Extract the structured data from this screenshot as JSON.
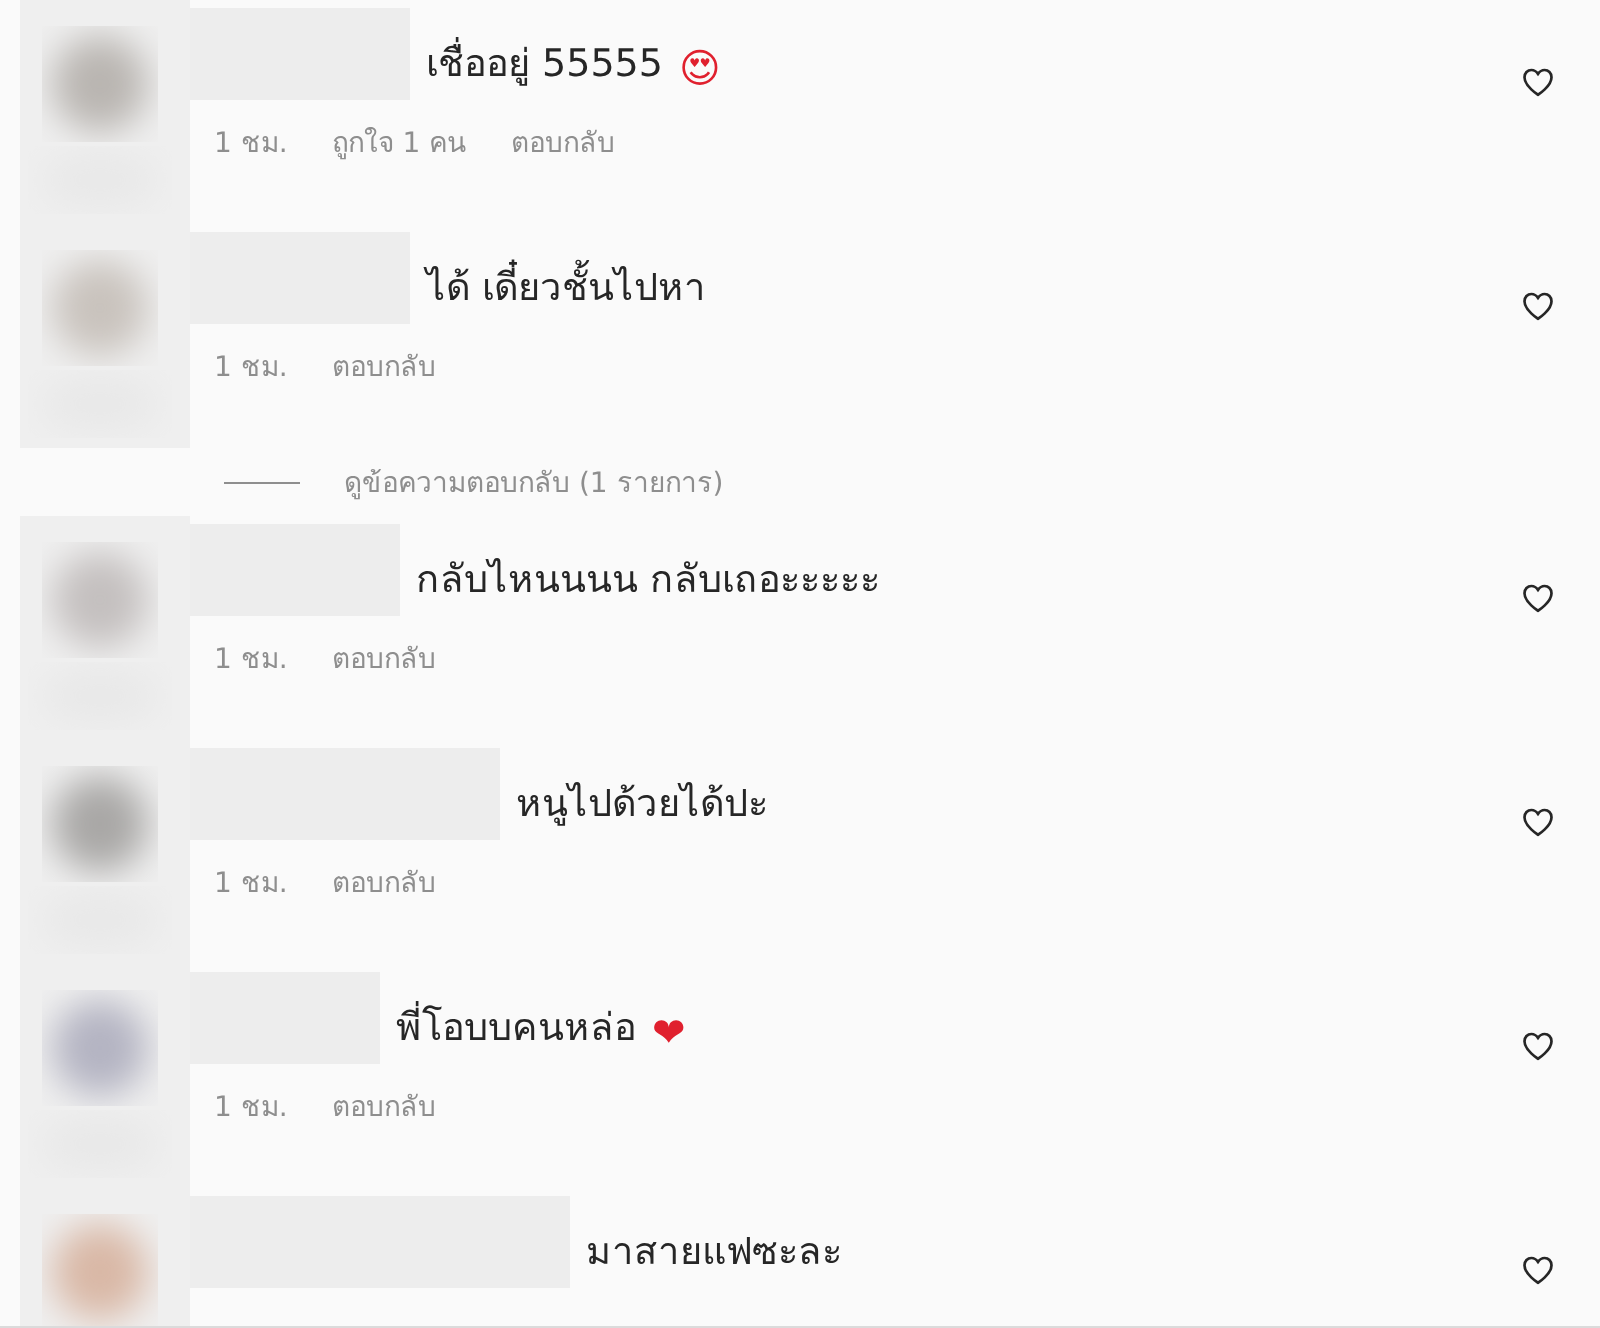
{
  "comments": [
    {
      "text": "เชื่ออยู่ 55555",
      "emoji": "😍",
      "time": "1 ชม.",
      "likes": "ถูกใจ 1 คน",
      "reply": "ตอบกลับ",
      "liked": false
    },
    {
      "text": "ได้ เดี๋ยวชั้นไปหา",
      "time": "1 ชม.",
      "reply": "ตอบกลับ",
      "liked": false,
      "view_replies": "ดูข้อความตอบกลับ (1 รายการ)"
    },
    {
      "text": "กลับไหนนนน กลับเถอะะะะะ",
      "time": "1 ชม.",
      "reply": "ตอบกลับ",
      "liked": false
    },
    {
      "text": "หนูไปด้วยได้ปะ",
      "time": "1 ชม.",
      "reply": "ตอบกลับ",
      "liked": false
    },
    {
      "text": "พี่โอบบคนหล่อ",
      "emoji": "❤",
      "time": "1 ชม.",
      "reply": "ตอบกลับ",
      "liked": false
    },
    {
      "text": "มาสายแฟซะละ",
      "liked": false
    }
  ]
}
